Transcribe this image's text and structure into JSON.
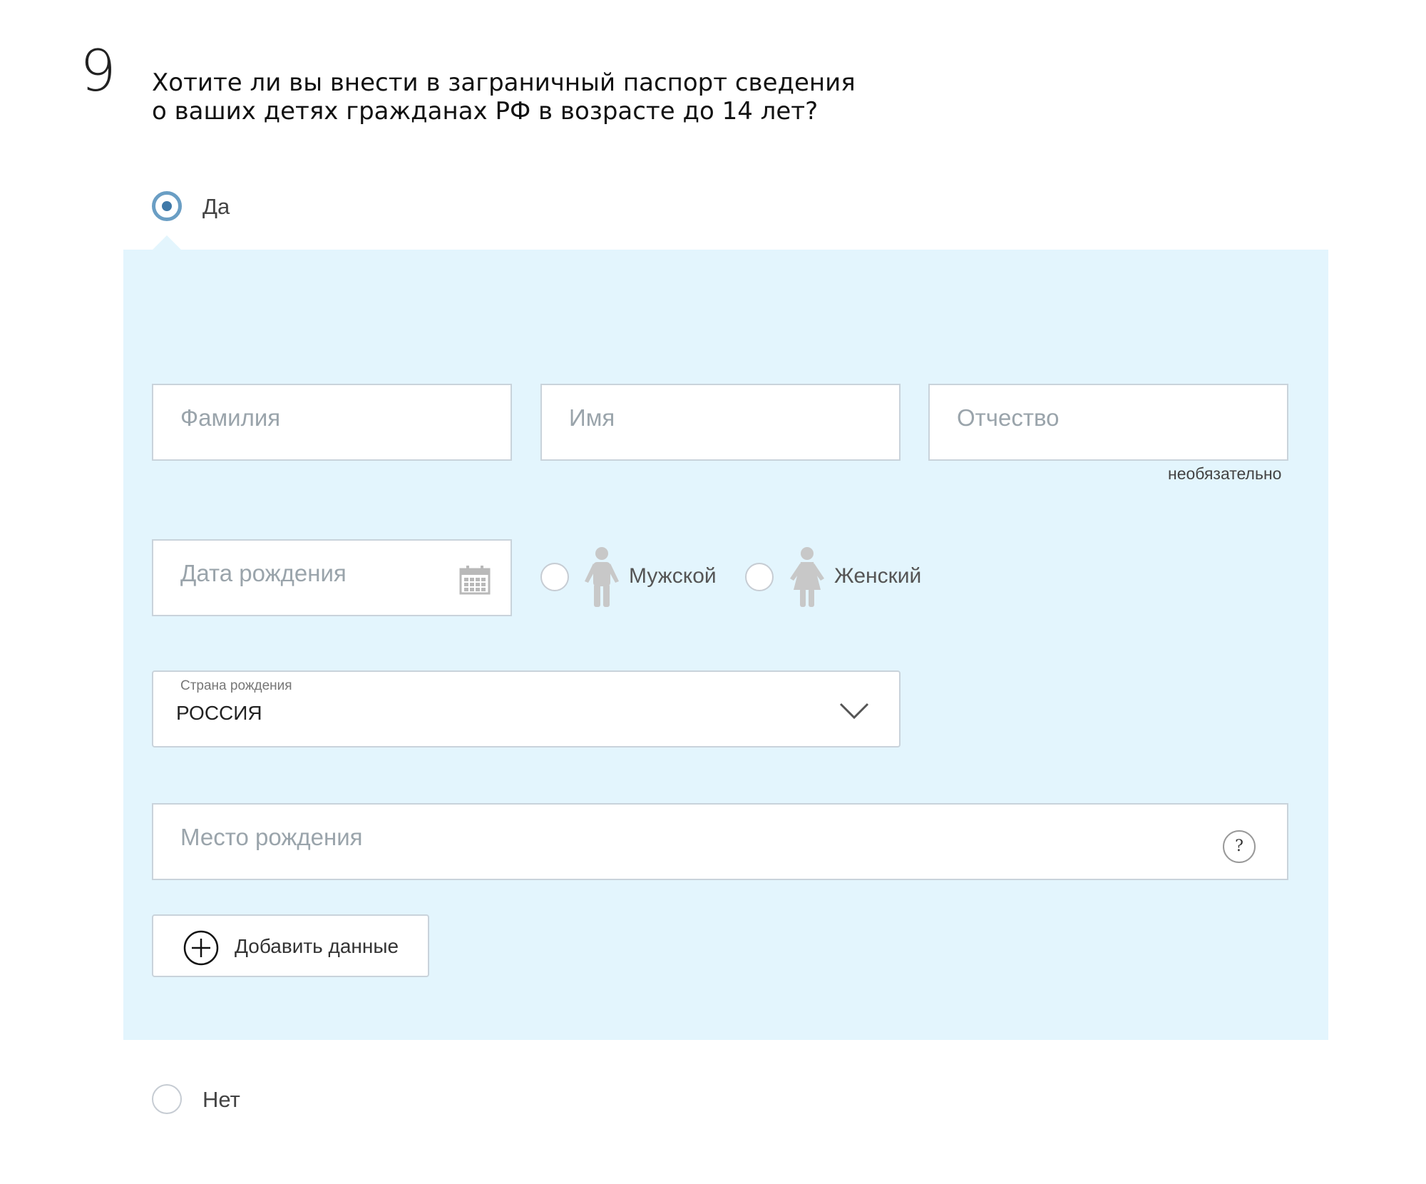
{
  "step": {
    "number": "9",
    "question": "Хотите ли вы внести в заграничный паспорт сведения о ваших детях гражданах РФ в возрасте до 14 лет?"
  },
  "options": {
    "yes": {
      "label": "Да",
      "selected": true
    },
    "no": {
      "label": "Нет",
      "selected": false
    }
  },
  "child_form": {
    "last_name": {
      "placeholder": "Фамилия"
    },
    "first_name": {
      "placeholder": "Имя"
    },
    "patronymic": {
      "placeholder": "Отчество",
      "hint": "необязательно"
    },
    "birth_date": {
      "placeholder": "Дата рождения",
      "icon": "calendar-icon"
    },
    "gender": {
      "male": {
        "label": "Мужской",
        "icon": "boy-icon",
        "selected": false
      },
      "female": {
        "label": "Женский",
        "icon": "girl-icon",
        "selected": false
      }
    },
    "birth_country": {
      "label": "Страна рождения",
      "value": "РОССИЯ",
      "icon": "chevron-down-icon"
    },
    "birth_place": {
      "placeholder": "Место рождения",
      "help": "?"
    },
    "add_button": {
      "label": "Добавить данные",
      "icon": "plus-circle-icon"
    }
  },
  "colors": {
    "panel_background": "#e3f5fd",
    "radio_accent": "#3f79a8",
    "field_border": "#c9d3db",
    "placeholder": "#9aa4ab",
    "gender_icon": "#c8c8c8"
  }
}
